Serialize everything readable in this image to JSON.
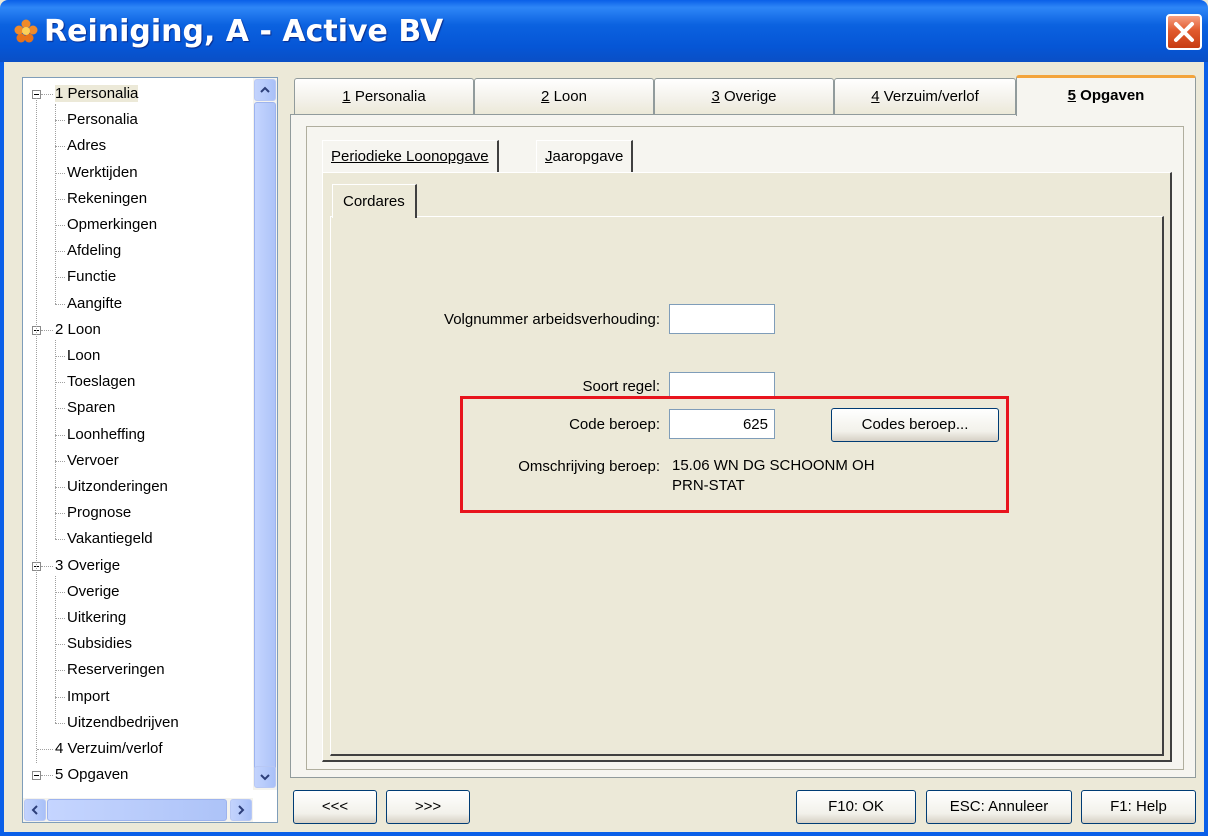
{
  "window": {
    "title": "Reiniging, A - Active BV",
    "icon": "app-flower-icon",
    "close_icon": "close-icon"
  },
  "tree": {
    "items": [
      {
        "label": "1 Personalia",
        "level": 0,
        "expanded": true,
        "selected": true
      },
      {
        "label": "Personalia",
        "level": 1
      },
      {
        "label": "Adres",
        "level": 1
      },
      {
        "label": "Werktijden",
        "level": 1
      },
      {
        "label": "Rekeningen",
        "level": 1
      },
      {
        "label": "Opmerkingen",
        "level": 1
      },
      {
        "label": "Afdeling",
        "level": 1
      },
      {
        "label": "Functie",
        "level": 1
      },
      {
        "label": "Aangifte",
        "level": 1
      },
      {
        "label": "2 Loon",
        "level": 0,
        "expanded": true
      },
      {
        "label": "Loon",
        "level": 1
      },
      {
        "label": "Toeslagen",
        "level": 1
      },
      {
        "label": "Sparen",
        "level": 1
      },
      {
        "label": "Loonheffing",
        "level": 1
      },
      {
        "label": "Vervoer",
        "level": 1
      },
      {
        "label": "Uitzonderingen",
        "level": 1
      },
      {
        "label": "Prognose",
        "level": 1
      },
      {
        "label": "Vakantiegeld",
        "level": 1
      },
      {
        "label": "3 Overige",
        "level": 0,
        "expanded": true
      },
      {
        "label": "Overige",
        "level": 1
      },
      {
        "label": "Uitkering",
        "level": 1
      },
      {
        "label": "Subsidies",
        "level": 1
      },
      {
        "label": "Reserveringen",
        "level": 1
      },
      {
        "label": "Import",
        "level": 1
      },
      {
        "label": "Uitzendbedrijven",
        "level": 1
      },
      {
        "label": "4 Verzuim/verlof",
        "level": 0,
        "leaf": true
      },
      {
        "label": "5 Opgaven",
        "level": 0,
        "expanded": true
      }
    ]
  },
  "tabs": [
    {
      "key": "1",
      "label": "Personalia"
    },
    {
      "key": "2",
      "label": "Loon"
    },
    {
      "key": "3",
      "label": "Overige"
    },
    {
      "key": "4",
      "label": "Verzuim/verlof"
    },
    {
      "key": "5",
      "label": "Opgaven",
      "active": true
    }
  ],
  "subtabs": {
    "periodiek": "Periodieke Loonopgave",
    "jaar_key": "J",
    "jaar_rest": "aaropgave",
    "cordares": "Cordares"
  },
  "form": {
    "volgnummer_label": "Volgnummer arbeidsverhouding:",
    "volgnummer_value": "",
    "soort_label": "Soort regel:",
    "soort_value": "",
    "code_label": "Code beroep:",
    "code_value": "625",
    "codes_button": "Codes beroep...",
    "omschrijving_label": "Omschrijving beroep:",
    "omschrijving_line1": "15.06 WN DG SCHOONM OH",
    "omschrijving_line2": "PRN-STAT"
  },
  "footer": {
    "prev": "<<<",
    "next": ">>>",
    "ok": "F10: OK",
    "cancel": "ESC: Annuleer",
    "help": "F1: Help"
  },
  "colors": {
    "titlebar": "#0A5FE8",
    "active_tab_accent": "#F3A43B",
    "highlight_box": "#E8141D"
  }
}
